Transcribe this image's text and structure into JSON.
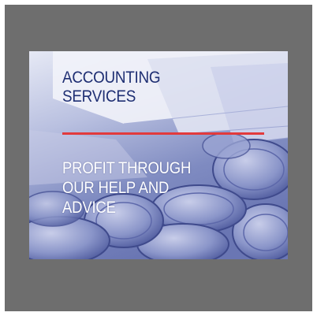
{
  "banner": {
    "headline": [
      "ACCOUNTING",
      "SERVICES"
    ],
    "tagline": [
      "PROFIT THROUGH",
      "OUR HELP AND",
      "ADVICE"
    ]
  },
  "colors": {
    "frame": "#6e6e6e",
    "headline": "#1f2f73",
    "divider": "#e23a3c",
    "tagline": "#ffffff",
    "background_tint": "#8d97c8"
  },
  "icons": [
    "banknotes-image",
    "coins-image"
  ]
}
